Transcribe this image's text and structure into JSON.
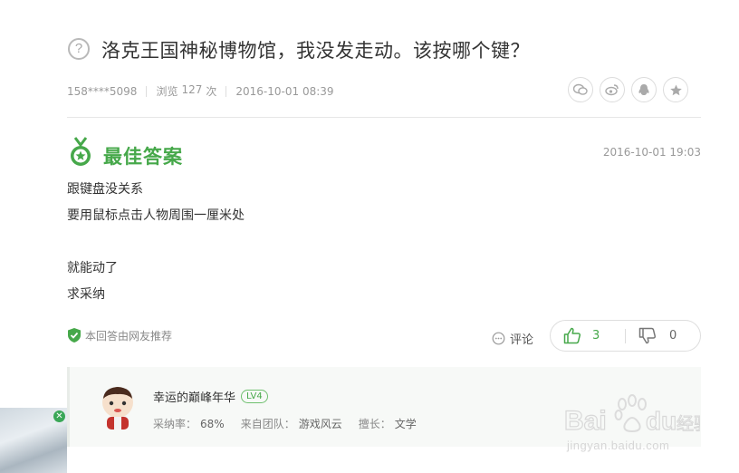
{
  "question": {
    "icon": "question-circle-icon",
    "title": "洛克王国神秘博物馆，我没发走动。该按哪个键？",
    "user": "158****5098",
    "views_label": "浏览",
    "views_count": "127",
    "views_unit": "次",
    "time": "2016-10-01 08:39"
  },
  "share": [
    "wechat-icon",
    "weibo-icon",
    "qq-icon",
    "favorite-star-icon"
  ],
  "best_answer": {
    "label": "最佳答案",
    "time": "2016-10-01 19:03",
    "lines": [
      "跟键盘没关系",
      "要用鼠标点击人物周围一厘米处",
      "",
      "就能动了",
      "求采纳"
    ],
    "recommend": "本回答由网友推荐",
    "comment_label": "评论",
    "upvotes": "3",
    "downvotes": "0"
  },
  "answerer": {
    "name": "幸运的巅峰年华",
    "level": "LV4",
    "adopt_label": "采纳率：",
    "adopt_rate": "68%",
    "team_label": "来自团队：",
    "team": "游戏风云",
    "skill_label": "擅长：",
    "skill": "文学"
  },
  "watermark": {
    "url": "jingyan.baidu.com"
  },
  "colors": {
    "accent_green": "#46a84a",
    "text": "#333333",
    "muted": "#999999"
  }
}
